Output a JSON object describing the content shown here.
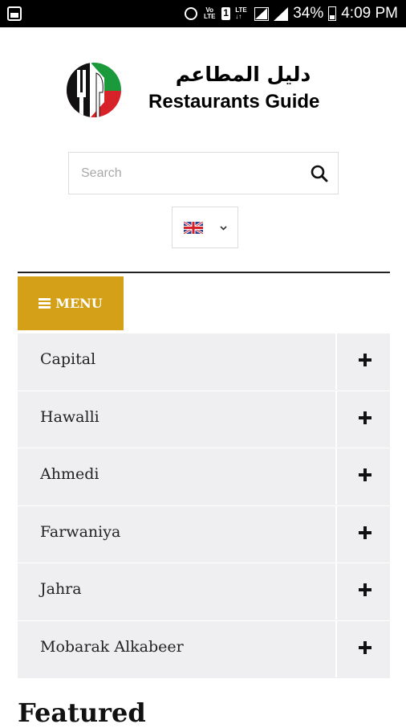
{
  "status_bar": {
    "battery": "34%",
    "time": "4:09 PM",
    "icons": [
      "image-icon",
      "alarm-icon",
      "volte-icon",
      "sim-icon",
      "lte-icon",
      "signal-icon",
      "signal-icon",
      "battery-icon"
    ]
  },
  "header": {
    "title_ar": "دليل المطاعم",
    "title_en": "Restaurants Guide"
  },
  "search": {
    "placeholder": "Search",
    "value": ""
  },
  "language": {
    "selected_flag": "uk-flag-icon"
  },
  "menu": {
    "label": "MENU",
    "items": [
      {
        "label": "Capital"
      },
      {
        "label": "Hawalli"
      },
      {
        "label": "Ahmedi"
      },
      {
        "label": "Farwaniya"
      },
      {
        "label": "Jahra"
      },
      {
        "label": "Mobarak Alkabeer"
      }
    ]
  },
  "section": {
    "featured_title": "Featured"
  },
  "colors": {
    "accent": "#d4a017",
    "nav_bg": "#efeff1"
  }
}
